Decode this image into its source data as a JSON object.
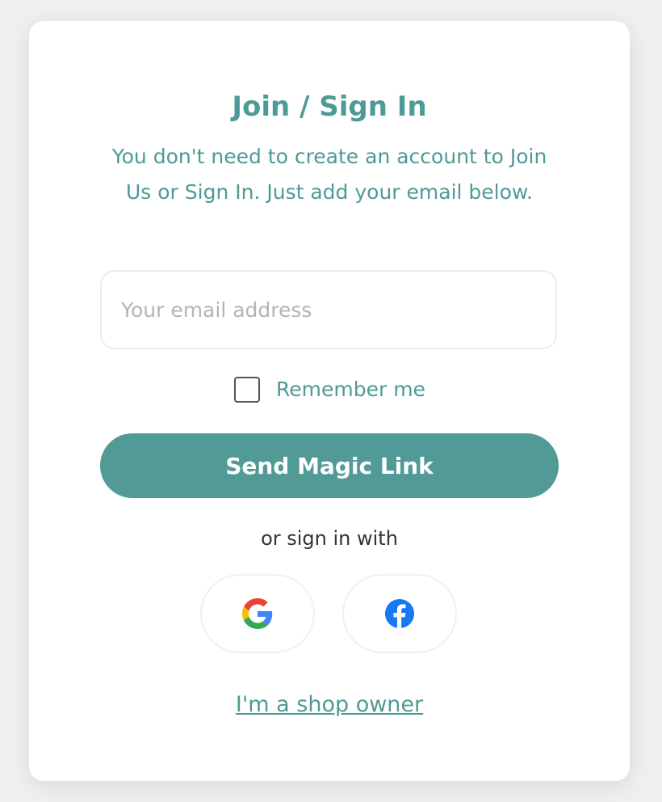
{
  "card": {
    "title": "Join / Sign In",
    "subtitle": "You don't need to create an account to Join Us or Sign In. Just add your email below."
  },
  "email": {
    "placeholder": "Your email address",
    "value": ""
  },
  "remember": {
    "label": "Remember me",
    "checked": false
  },
  "submit": {
    "label": "Send Magic Link"
  },
  "social": {
    "divider_text": "or sign in with",
    "providers": [
      {
        "name": "google",
        "icon": "google-icon"
      },
      {
        "name": "facebook",
        "icon": "facebook-icon"
      }
    ]
  },
  "footer": {
    "shop_owner_link": "I'm a shop owner"
  },
  "colors": {
    "accent": "#529a96",
    "text_accent": "#4e9a96",
    "background": "#f0f0f0",
    "card": "#ffffff",
    "facebook": "#1877f2"
  }
}
